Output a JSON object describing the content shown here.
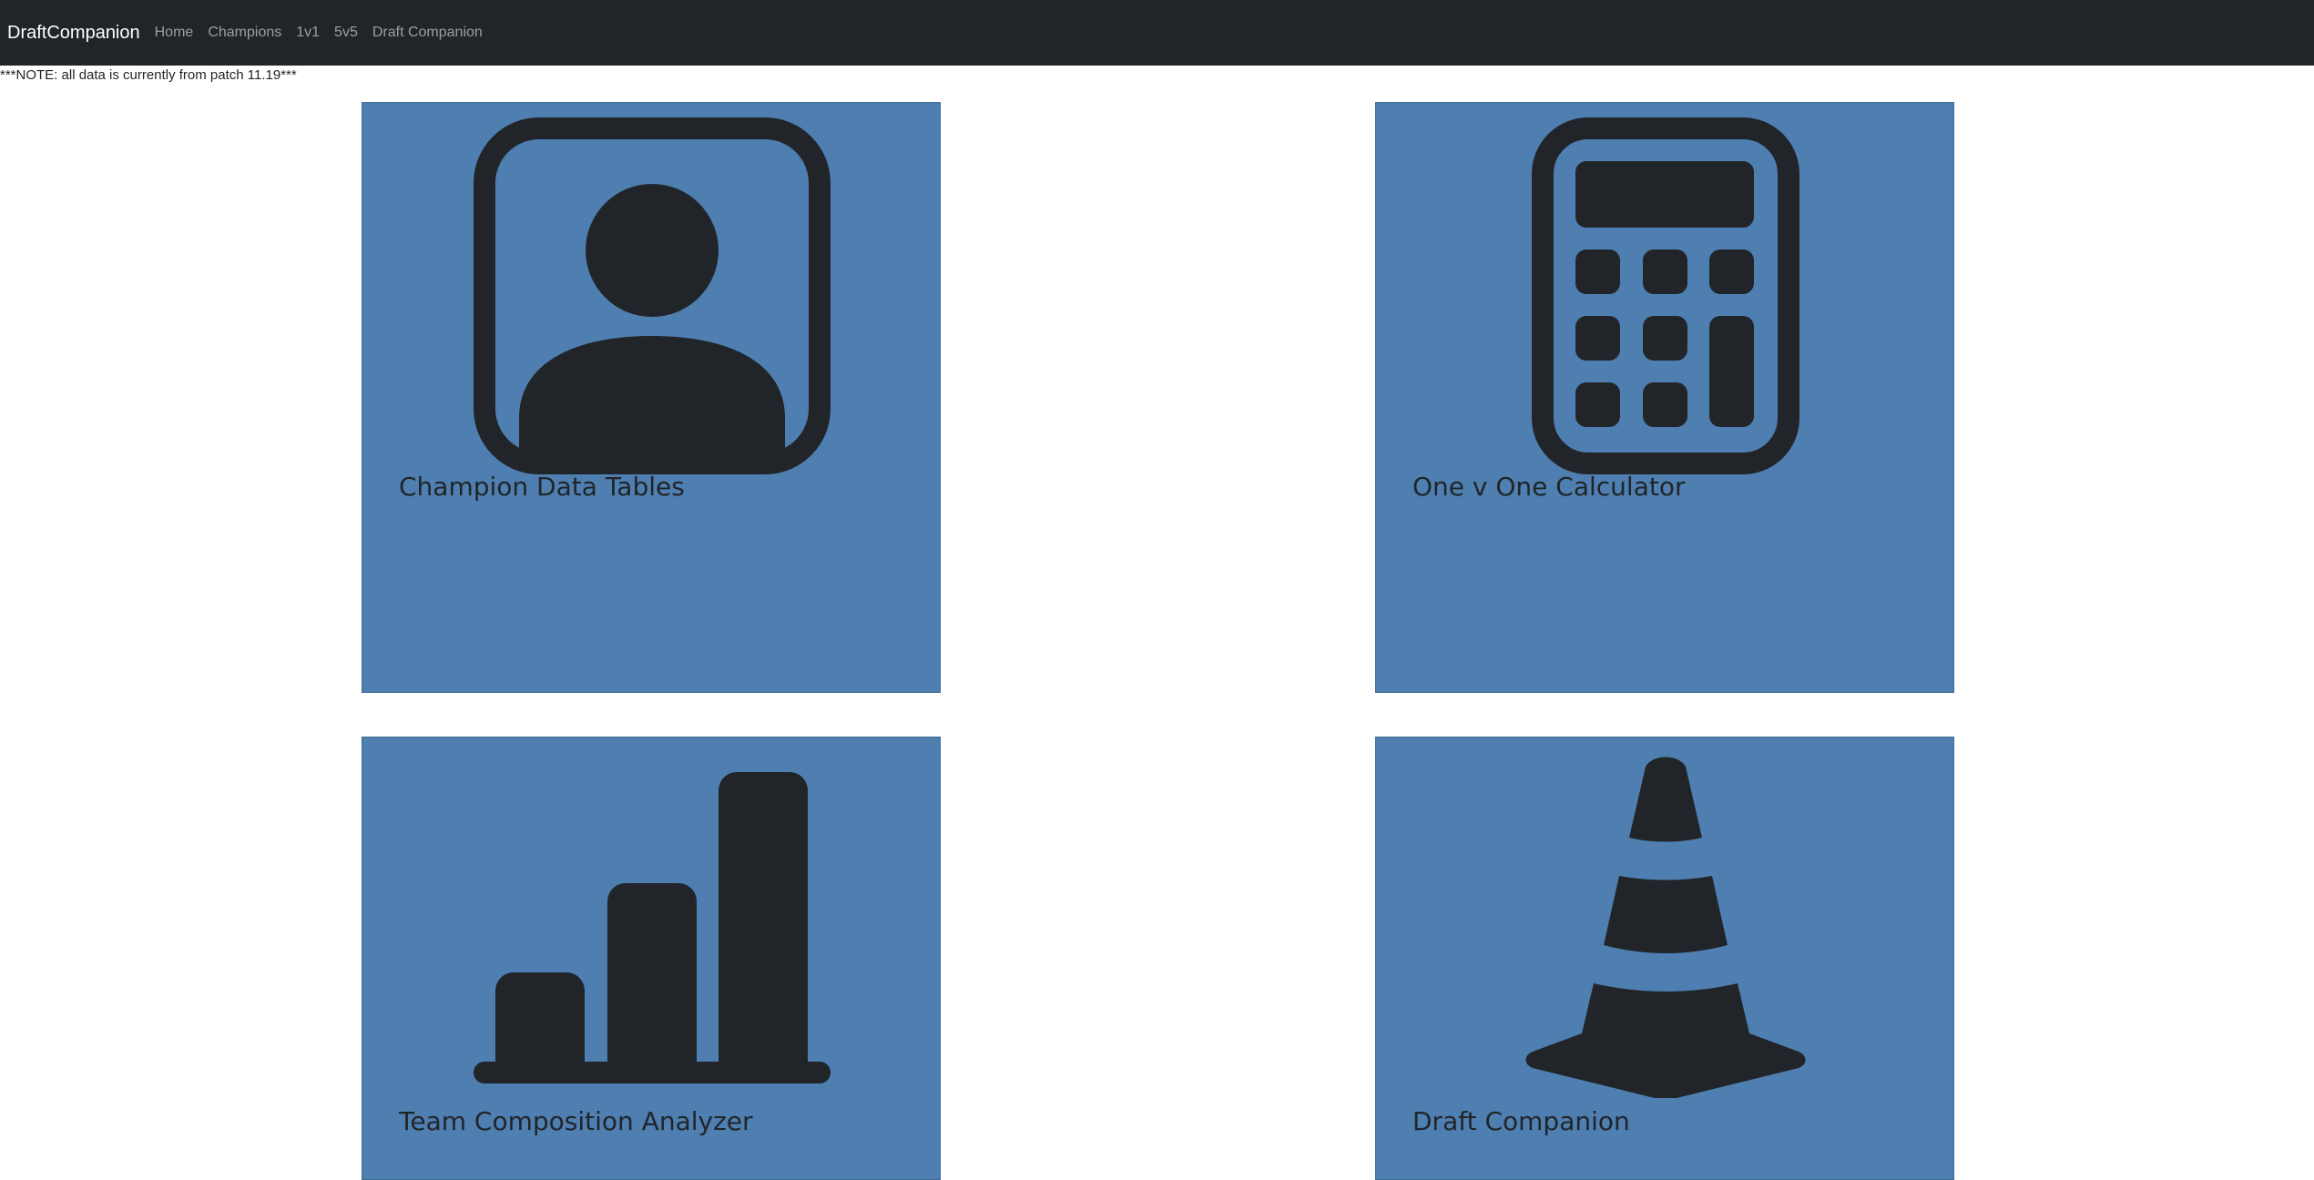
{
  "navbar": {
    "brand": "DraftCompanion",
    "links": [
      "Home",
      "Champions",
      "1v1",
      "5v5",
      "Draft Companion"
    ]
  },
  "note": "***NOTE: all data is currently from patch 11.19***",
  "cards": [
    {
      "title": "Champion Data Tables",
      "icon": "person-square-icon"
    },
    {
      "title": "One v One Calculator",
      "icon": "calculator-icon"
    },
    {
      "title": "Team Composition Analyzer",
      "icon": "bar-chart-icon"
    },
    {
      "title": "Draft Companion",
      "icon": "cone-icon"
    }
  ],
  "colors": {
    "navbar_bg": "#212529",
    "card_bg": "#4e7fb0",
    "icon_fill": "#212529"
  }
}
